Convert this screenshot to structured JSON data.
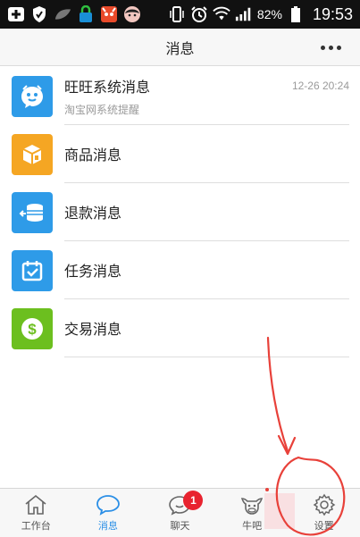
{
  "status_bar": {
    "battery_percent": "82%",
    "time": "19:53",
    "icons": [
      "add-icon",
      "shield-icon",
      "leaf-icon",
      "lock-icon",
      "cat-icon",
      "avatar-icon",
      "vibrate-icon",
      "alarm-icon",
      "wifi-icon",
      "signal-icon",
      "battery-icon"
    ]
  },
  "header": {
    "title": "消息",
    "more_icon": "more-dots-icon"
  },
  "messages": [
    {
      "title": "旺旺系统消息",
      "subtitle": "淘宝网系统提醒",
      "time": "12-26 20:24",
      "icon": "wangwang-icon",
      "color": "#2e9be8"
    },
    {
      "title": "商品消息",
      "subtitle": "",
      "time": "",
      "icon": "box-icon",
      "color": "#f5a623"
    },
    {
      "title": "退款消息",
      "subtitle": "",
      "time": "",
      "icon": "refund-icon",
      "color": "#2e9be8"
    },
    {
      "title": "任务消息",
      "subtitle": "",
      "time": "",
      "icon": "calendar-check-icon",
      "color": "#2e9be8"
    },
    {
      "title": "交易消息",
      "subtitle": "",
      "time": "",
      "icon": "dollar-icon",
      "color": "#6cbf1f"
    }
  ],
  "bottom_nav": {
    "items": [
      {
        "label": "工作台",
        "icon": "home-icon",
        "active": false,
        "badge": ""
      },
      {
        "label": "消息",
        "icon": "chat-bubble-icon",
        "active": true,
        "badge": ""
      },
      {
        "label": "聊天",
        "icon": "chat-face-icon",
        "active": false,
        "badge": "1"
      },
      {
        "label": "牛吧",
        "icon": "cow-icon",
        "active": false,
        "badge": ""
      },
      {
        "label": "设置",
        "icon": "gear-icon",
        "active": false,
        "badge": ""
      }
    ]
  },
  "colors": {
    "accent": "#2b8fe6",
    "badge": "#e8232f",
    "annotation": "#e8413a"
  }
}
